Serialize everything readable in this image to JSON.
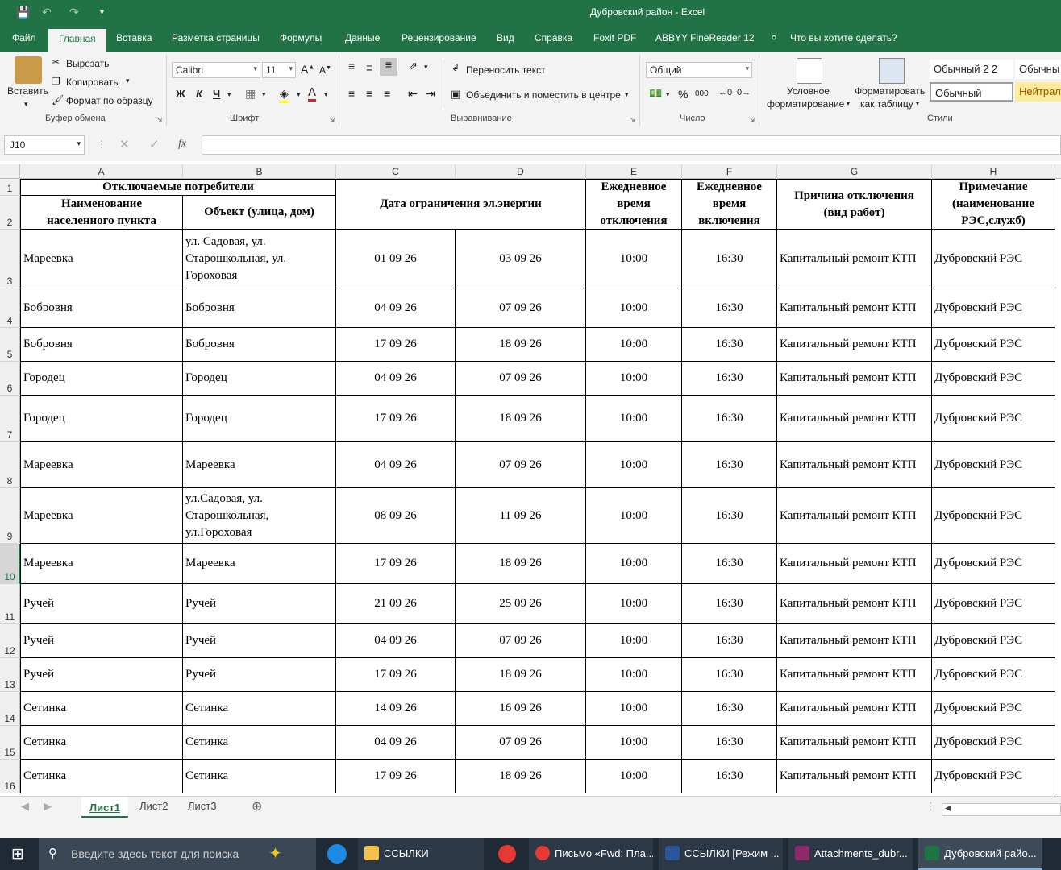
{
  "window": {
    "title": "Дубровский район  -  Excel"
  },
  "quick_access": [
    "save-icon",
    "undo-icon",
    "redo-icon",
    "customize-icon"
  ],
  "menu_tabs": [
    "Файл",
    "Главная",
    "Вставка",
    "Разметка страницы",
    "Формулы",
    "Данные",
    "Рецензирование",
    "Вид",
    "Справка",
    "Foxit PDF",
    "ABBYY FineReader 12"
  ],
  "tell_me": "Что вы хотите сделать?",
  "ribbon": {
    "clipboard": {
      "paste": "Вставить",
      "cut": "Вырезать",
      "copy": "Копировать",
      "format_painter": "Формат по образцу",
      "label": "Буфер обмена"
    },
    "font": {
      "name": "Calibri",
      "size": "11",
      "bold": "Ж",
      "italic": "К",
      "underline": "Ч",
      "label": "Шрифт"
    },
    "alignment": {
      "wrap": "Переносить текст",
      "merge": "Объединить и поместить в центре",
      "label": "Выравнивание"
    },
    "number": {
      "format": "Общий",
      "percent": "%",
      "thousands": "000",
      "label": "Число"
    },
    "styles": {
      "conditional_1": "Условное",
      "conditional_2": "форматирование",
      "table_1": "Форматировать",
      "table_2": "как таблицу",
      "style_1": "Обычный 2 2",
      "style_2": "Обычны",
      "style_3": "Обычный",
      "style_4": "Нейтрал",
      "label": "Стили"
    }
  },
  "formula_bar": {
    "name_box": "J10",
    "fx": "fx",
    "value": ""
  },
  "columns": [
    "A",
    "B",
    "C",
    "D",
    "E",
    "F",
    "G",
    "H"
  ],
  "rows": [
    "1",
    "2",
    "3",
    "4",
    "5",
    "6",
    "7",
    "8",
    "9",
    "10",
    "11",
    "12",
    "13",
    "14",
    "15",
    "16"
  ],
  "header": {
    "consumers": "Отключаемые потребители",
    "settlement": "Наименование населенного пункта",
    "object": "Объект (улица, дом)",
    "date": "Дата ограничения эл.энергии",
    "off_time": "Ежедневное время отключения",
    "on_time": "Ежедневное время включения",
    "reason": "Причина отключения (вид работ)",
    "note": "Примечание (наименование РЭС,служб)"
  },
  "table_rows": [
    {
      "a": "Мареевка",
      "b": "ул. Садовая, ул. Старошкольная, ул. Гороховая",
      "c": "01 09 26",
      "d": "03 09 26",
      "e": "10:00",
      "f": "16:30",
      "g": "Капитальный ремонт КТП",
      "h": "Дубровский РЭС"
    },
    {
      "a": "Бобровня",
      "b": "Бобровня",
      "c": "04 09 26",
      "d": "07 09 26",
      "e": "10:00",
      "f": "16:30",
      "g": "Капитальный ремонт КТП",
      "h": "Дубровский РЭС"
    },
    {
      "a": "Бобровня",
      "b": "Бобровня",
      "c": "17 09 26",
      "d": "18 09 26",
      "e": "10:00",
      "f": "16:30",
      "g": "Капитальный ремонт КТП",
      "h": "Дубровский РЭС"
    },
    {
      "a": "Городец",
      "b": "Городец",
      "c": "04 09 26",
      "d": "07 09 26",
      "e": "10:00",
      "f": "16:30",
      "g": "Капитальный ремонт КТП",
      "h": "Дубровский РЭС"
    },
    {
      "a": "Городец",
      "b": "Городец",
      "c": "17 09 26",
      "d": "18 09 26",
      "e": "10:00",
      "f": "16:30",
      "g": "Капитальный ремонт КТП",
      "h": "Дубровский РЭС"
    },
    {
      "a": "Мареевка",
      "b": "Мареевка",
      "c": "04 09 26",
      "d": "07 09 26",
      "e": "10:00",
      "f": "16:30",
      "g": "Капитальный ремонт КТП",
      "h": "Дубровский РЭС"
    },
    {
      "a": "Мареевка",
      "b": "ул.Садовая, ул. Старошкольная, ул.Гороховая",
      "c": "08 09 26",
      "d": "11 09 26",
      "e": "10:00",
      "f": "16:30",
      "g": "Капитальный ремонт КТП",
      "h": "Дубровский РЭС"
    },
    {
      "a": "Мареевка",
      "b": "Мареевка",
      "c": "17 09 26",
      "d": "18 09 26",
      "e": "10:00",
      "f": "16:30",
      "g": "Капитальный ремонт КТП",
      "h": "Дубровский РЭС"
    },
    {
      "a": "Ручей",
      "b": "Ручей",
      "c": "21 09 26",
      "d": "25 09 26",
      "e": "10:00",
      "f": "16:30",
      "g": "Капитальный ремонт КТП",
      "h": "Дубровский РЭС"
    },
    {
      "a": "Ручей",
      "b": "Ручей",
      "c": "04 09 26",
      "d": "07 09 26",
      "e": "10:00",
      "f": "16:30",
      "g": "Капитальный ремонт КТП",
      "h": "Дубровский РЭС"
    },
    {
      "a": "Ручей",
      "b": "Ручей",
      "c": "17 09 26",
      "d": "18 09 26",
      "e": "10:00",
      "f": "16:30",
      "g": "Капитальный ремонт КТП",
      "h": "Дубровский РЭС"
    },
    {
      "a": "Сетинка",
      "b": "Сетинка",
      "c": "14 09 26",
      "d": "16 09 26",
      "e": "10:00",
      "f": "16:30",
      "g": "Капитальный ремонт КТП",
      "h": "Дубровский РЭС"
    },
    {
      "a": "Сетинка",
      "b": "Сетинка",
      "c": "04 09 26",
      "d": "07 09 26",
      "e": "10:00",
      "f": "16:30",
      "g": "Капитальный ремонт КТП",
      "h": "Дубровский РЭС"
    },
    {
      "a": "Сетинка",
      "b": "Сетинка",
      "c": "17 09 26",
      "d": "18 09 26",
      "e": "10:00",
      "f": "16:30",
      "g": "Капитальный ремонт КТП",
      "h": "Дубровский РЭС"
    }
  ],
  "sheets": [
    "Лист1",
    "Лист2",
    "Лист3"
  ],
  "taskbar": {
    "search_placeholder": "Введите здесь текст для поиска",
    "items": [
      "ССЫЛКИ",
      "Письмо «Fwd: Пла...",
      "ССЫЛКИ [Режим ...",
      "Attachments_dubr...",
      "Дубровский райо..."
    ]
  },
  "colors": {
    "excel_green": "#217346",
    "taskbar": "#1f2a35"
  }
}
